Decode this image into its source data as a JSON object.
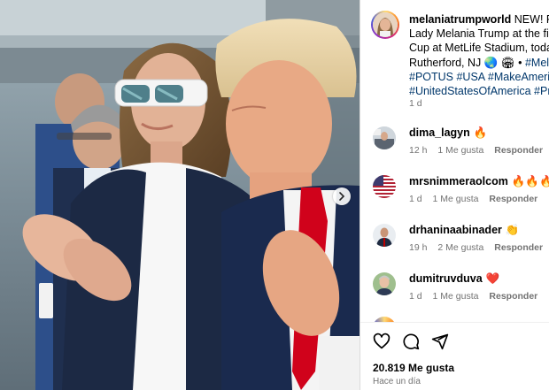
{
  "post": {
    "caption": {
      "username": "melaniatrumpworld",
      "line1": "NEW! Pres",
      "line2": "Lady Melania Trump at the fina",
      "line3": "Cup at MetLife Stadium, today",
      "line4_text": "Rutherford, NJ 🌏 🏟 • ",
      "line4_tag": "#Melani",
      "line5": "#POTUS #USA #MakeAmericaG",
      "line6": "#UnitedStatesOfAmerica #Pres"
    },
    "timestamp": "1 d",
    "likes": "20.819 Me gusta",
    "posted": "Hace un día"
  },
  "comments": [
    {
      "username": "dima_lagyn",
      "emoji": "🔥",
      "time": "12 h",
      "likes": "1 Me gusta",
      "reply": "Responder",
      "avatar": "avatar-office"
    },
    {
      "username": "mrsnimmeraolcom",
      "emoji": "🔥🔥🔥🔥",
      "time": "1 d",
      "likes": "1 Me gusta",
      "reply": "Responder",
      "avatar": "avatar-us-flag"
    },
    {
      "username": "drhaninaabinader",
      "emoji": "👏",
      "time": "19 h",
      "likes": "2 Me gusta",
      "reply": "Responder",
      "avatar": "avatar-suit"
    },
    {
      "username": "dumitruvduva",
      "emoji": "❤️",
      "time": "1 d",
      "likes": "1 Me gusta",
      "reply": "Responder",
      "avatar": "avatar-portrait"
    }
  ],
  "icons": {
    "like": "heart-icon",
    "comment": "comment-bubble-icon",
    "share": "paper-plane-icon",
    "carousel": "chevron-right-icon"
  },
  "colors": {
    "hashtag": "#00376b",
    "muted": "#737373",
    "tie": "#d0021b",
    "fire": "#f0651f",
    "heart": "#ed4956",
    "clap": "#f4c23c"
  }
}
